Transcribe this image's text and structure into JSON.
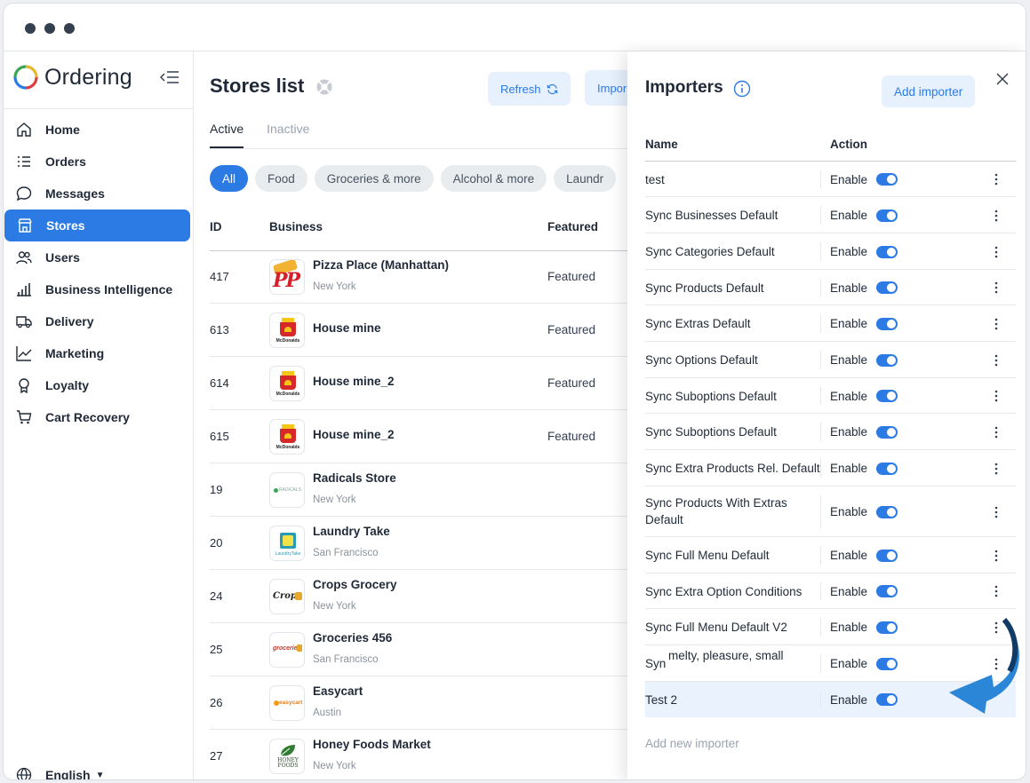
{
  "brand": {
    "name": "Ordering"
  },
  "sidebar": {
    "items": [
      {
        "label": "Home",
        "icon": "home-icon"
      },
      {
        "label": "Orders",
        "icon": "list-icon"
      },
      {
        "label": "Messages",
        "icon": "chat-icon"
      },
      {
        "label": "Stores",
        "icon": "store-icon",
        "active": true
      },
      {
        "label": "Users",
        "icon": "users-icon"
      },
      {
        "label": "Business Intelligence",
        "icon": "bar-chart-icon"
      },
      {
        "label": "Delivery",
        "icon": "truck-icon"
      },
      {
        "label": "Marketing",
        "icon": "trend-icon"
      },
      {
        "label": "Loyalty",
        "icon": "medal-icon"
      },
      {
        "label": "Cart Recovery",
        "icon": "cart-icon"
      }
    ],
    "language": "English"
  },
  "main": {
    "title": "Stores list",
    "refresh_label": "Refresh",
    "import_label": "Impor",
    "tabs": [
      "Active",
      "Inactive"
    ],
    "chips": [
      "All",
      "Food",
      "Groceries & more",
      "Alcohol & more",
      "Laundr"
    ],
    "columns": {
      "id": "ID",
      "business": "Business",
      "featured": "Featured"
    },
    "rows": [
      {
        "id": "417",
        "name": "Pizza Place (Manhattan)",
        "city": "New York",
        "featured": "Featured"
      },
      {
        "id": "613",
        "name": "House mine",
        "city": "",
        "featured": "Featured"
      },
      {
        "id": "614",
        "name": "House mine_2",
        "city": "",
        "featured": "Featured"
      },
      {
        "id": "615",
        "name": "House mine_2",
        "city": "",
        "featured": "Featured"
      },
      {
        "id": "19",
        "name": "Radicals Store",
        "city": "New York",
        "featured": ""
      },
      {
        "id": "20",
        "name": "Laundry Take",
        "city": "San Francisco",
        "featured": ""
      },
      {
        "id": "24",
        "name": "Crops Grocery",
        "city": "New York",
        "featured": ""
      },
      {
        "id": "25",
        "name": "Groceries 456",
        "city": "San Francisco",
        "featured": ""
      },
      {
        "id": "26",
        "name": "Easycart",
        "city": "Austin",
        "featured": ""
      },
      {
        "id": "27",
        "name": "Honey Foods Market",
        "city": "New York",
        "featured": ""
      }
    ],
    "logo_text": {
      "pp": "PP",
      "mcd": "McDonalds",
      "radicals": "RADICALS",
      "laundry": "LaundryTake",
      "crops": "Crops",
      "groceries": "groceries",
      "easycart": "easycart",
      "honey": "HONEY FOODS"
    }
  },
  "importers": {
    "title": "Importers",
    "add_label": "Add importer",
    "col_name": "Name",
    "col_action": "Action",
    "action_label": "Enable",
    "rows": [
      "test",
      "Sync Businesses Default",
      "Sync Categories Default",
      "Sync Products Default",
      "Sync Extras Default",
      "Sync Options Default",
      "Sync Suboptions Default",
      "Sync Suboptions Default",
      "Sync Extra Products Rel. Default",
      "Sync Products With Extras Default",
      "Sync Full Menu Default",
      "Sync Extra Option Conditions",
      "Sync Full Menu Default V2",
      "Syn",
      "Test 2"
    ],
    "tooltip": "melty, pleasure, small",
    "add_new": "Add new importer",
    "accent": "#2c7be5"
  }
}
